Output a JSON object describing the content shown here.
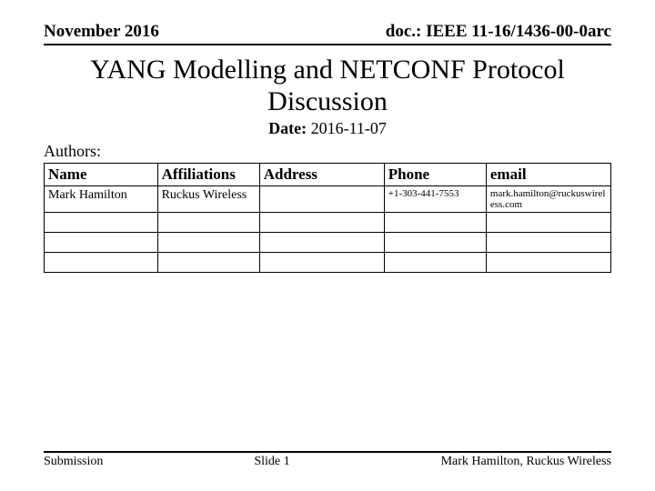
{
  "header": {
    "left": "November 2016",
    "right": "doc.: IEEE 11-16/1436-00-0arc"
  },
  "title": "YANG Modelling and NETCONF Protocol Discussion",
  "date": {
    "label": "Date:",
    "value": "2016-11-07"
  },
  "authors_label": "Authors:",
  "table": {
    "headers": {
      "name": "Name",
      "affiliations": "Affiliations",
      "address": "Address",
      "phone": "Phone",
      "email": "email"
    },
    "rows": [
      {
        "name": "Mark Hamilton",
        "affiliations": "Ruckus Wireless",
        "address": "",
        "phone": "+1-303-441-7553",
        "email": "mark.hamilton@ruckuswireless.com"
      },
      {
        "name": "",
        "affiliations": "",
        "address": "",
        "phone": "",
        "email": ""
      },
      {
        "name": "",
        "affiliations": "",
        "address": "",
        "phone": "",
        "email": ""
      },
      {
        "name": "",
        "affiliations": "",
        "address": "",
        "phone": "",
        "email": ""
      }
    ]
  },
  "footer": {
    "left": "Submission",
    "center": "Slide 1",
    "right": "Mark Hamilton, Ruckus Wireless"
  }
}
